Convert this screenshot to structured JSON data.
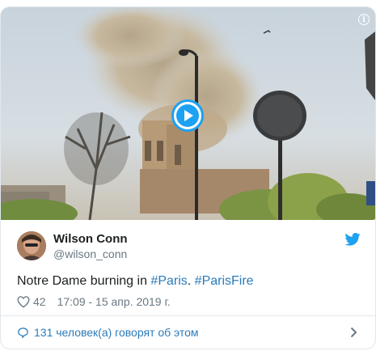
{
  "tweet": {
    "author_name": "Wilson Conn",
    "author_handle": "@wilson_conn",
    "text_before": "Notre Dame burning in ",
    "hashtag_1": "#Paris",
    "separator": ". ",
    "hashtag_2": "#ParisFire",
    "likes": "42",
    "timestamp": "17:09 - 15 апр. 2019 г.",
    "conversation_link": "131 человек(а) говорят об этом"
  },
  "icons": {
    "play": "play-icon",
    "info": "info-icon",
    "twitter": "twitter-bird-icon",
    "like": "heart-icon",
    "reply": "speech-bubble-icon",
    "chevron": "chevron-right-icon"
  },
  "colors": {
    "accent": "#1da1f2",
    "link": "#2b7bb9",
    "secondary_text": "#697882",
    "border": "#e1e8ed"
  }
}
